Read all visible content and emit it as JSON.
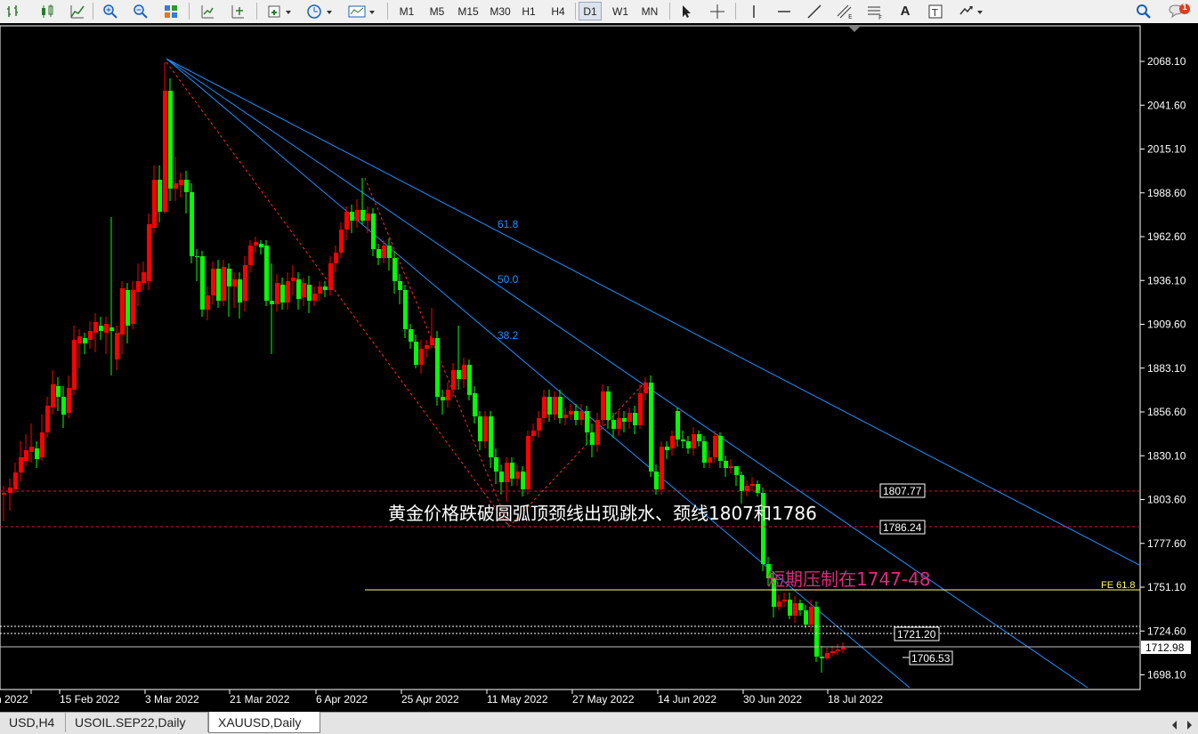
{
  "toolbar": {
    "timeframes": [
      "M1",
      "M5",
      "M15",
      "M30",
      "H1",
      "H4",
      "D1",
      "W1",
      "MN"
    ],
    "active_timeframe": "D1",
    "tools": {
      "text_tool": "A"
    },
    "notification_count": "1"
  },
  "chart": {
    "symbol": "XAUUSD",
    "timeframe": "Daily",
    "price_axis": [
      "2068.10",
      "2041.60",
      "2015.10",
      "1988.60",
      "1962.60",
      "1936.10",
      "1909.60",
      "1883.10",
      "1856.60",
      "1830.10",
      "1803.60",
      "1777.60",
      "1751.10",
      "1724.60",
      "1698.10"
    ],
    "date_axis": [
      "n 2022",
      "15 Feb 2022",
      "3 Mar 2022",
      "21 Mar 2022",
      "6 Apr 2022",
      "25 Apr 2022",
      "11 May 2022",
      "27 May 2022",
      "14 Jun 2022",
      "30 Jun 2022",
      "18 Jul 2022"
    ],
    "fib_fan_levels": [
      "61.8",
      "50.0",
      "38.2"
    ],
    "price_labels": {
      "neckline_upper": "1807.77",
      "neckline_lower": "1786.24",
      "fe_label": "FE 61.8",
      "level_1721": "1721.20",
      "current_price": "1712.98",
      "level_1706": "1706.53"
    },
    "annotations": {
      "main": "黄金价格跌破圆弧顶颈线出现跳水、颈线1807和1786",
      "resistance": "短期压制在1747-48"
    },
    "colors": {
      "background": "#000000",
      "bull_candle": "#ff0000",
      "bear_candle": "#00ff00",
      "fan_lines": "#1e90ff",
      "neckline": "#dc143c",
      "fe_line": "#ffff66",
      "resistance_text": "#e0287a"
    }
  },
  "tabs": [
    "USD,H4",
    "USOIL.SEP22,Daily",
    "XAUUSD,Daily"
  ],
  "active_tab": "XAUUSD,Daily",
  "chart_data": {
    "type": "candlestick",
    "title": "",
    "series": [
      {
        "name": "",
        "x": [
          "2022-01-27",
          "2022-02-15",
          "2022-03-03",
          "2022-03-21",
          "2022-04-06",
          "2022-04-25",
          "2022-05-11",
          "2022-05-27",
          "2022-06-14",
          "2022-06-30",
          "2022-07-18"
        ],
        "close_approx": [
          1805,
          1872,
          2040,
          1920,
          1925,
          1898,
          1852,
          1853,
          1832,
          1807,
          1712
        ]
      }
    ],
    "ylim": [
      1690,
      2080
    ],
    "horizontal_levels": [
      1807.77,
      1786.24,
      1747.5,
      1721.2,
      1712.98,
      1706.53
    ]
  }
}
